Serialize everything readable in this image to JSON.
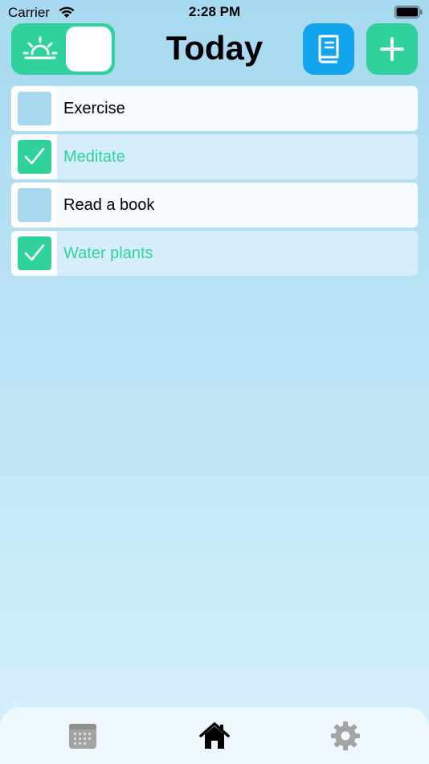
{
  "status_bar": {
    "carrier": "Carrier",
    "time": "2:28 PM"
  },
  "header": {
    "title": "Today",
    "mode_toggle_icon": "sunrise-icon",
    "journal_icon": "book-icon",
    "add_icon": "plus-icon"
  },
  "tasks": [
    {
      "label": "Exercise",
      "done": false
    },
    {
      "label": "Meditate",
      "done": true
    },
    {
      "label": "Read a book",
      "done": false
    },
    {
      "label": "Water plants",
      "done": true
    }
  ],
  "tab_bar": {
    "tabs": [
      {
        "icon": "calendar-icon",
        "active": false
      },
      {
        "icon": "home-icon",
        "active": true
      },
      {
        "icon": "gear-icon",
        "active": false
      }
    ]
  },
  "colors": {
    "accent_green": "#2fd29a",
    "accent_blue": "#10a5ec",
    "unchecked_box": "#a8d8ef"
  }
}
